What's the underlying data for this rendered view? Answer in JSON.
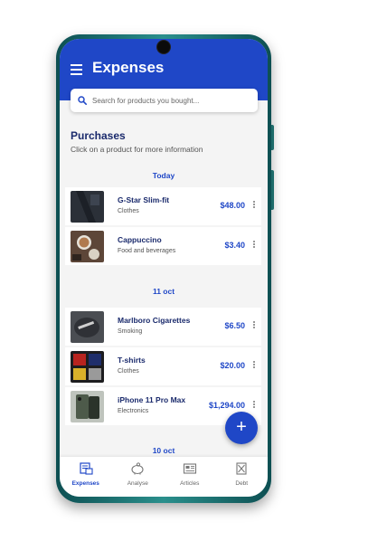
{
  "app": {
    "title": "Expenses"
  },
  "search": {
    "placeholder": "Search for products you bought..."
  },
  "purchases": {
    "title": "Purchases",
    "subtitle": "Click on a product for more information"
  },
  "groups": [
    {
      "date": "Today",
      "items": [
        {
          "name": "G-Star Slim-fit",
          "category": "Clothes",
          "price": "$48.00"
        },
        {
          "name": "Cappuccino",
          "category": "Food and beverages",
          "price": "$3.40"
        }
      ]
    },
    {
      "date": "11 oct",
      "items": [
        {
          "name": "Marlboro Cigarettes",
          "category": "Smoking",
          "price": "$6.50"
        },
        {
          "name": "T-shirts",
          "category": "Clothes",
          "price": "$20.00"
        },
        {
          "name": "iPhone 11 Pro Max",
          "category": "Electronics",
          "price": "$1,294.00"
        }
      ]
    },
    {
      "date": "10 oct",
      "items": []
    }
  ],
  "fab": {
    "label": "+"
  },
  "nav": [
    {
      "label": "Expenses",
      "icon": "receipt-icon",
      "active": true
    },
    {
      "label": "Analyse",
      "icon": "piggy-bank-icon",
      "active": false
    },
    {
      "label": "Articles",
      "icon": "newspaper-icon",
      "active": false
    },
    {
      "label": "Debt",
      "icon": "scissors-icon",
      "active": false
    }
  ],
  "colors": {
    "primary": "#1f47c7",
    "text_dark": "#1a2a6c",
    "phone_frame": "#1d6b6a"
  }
}
